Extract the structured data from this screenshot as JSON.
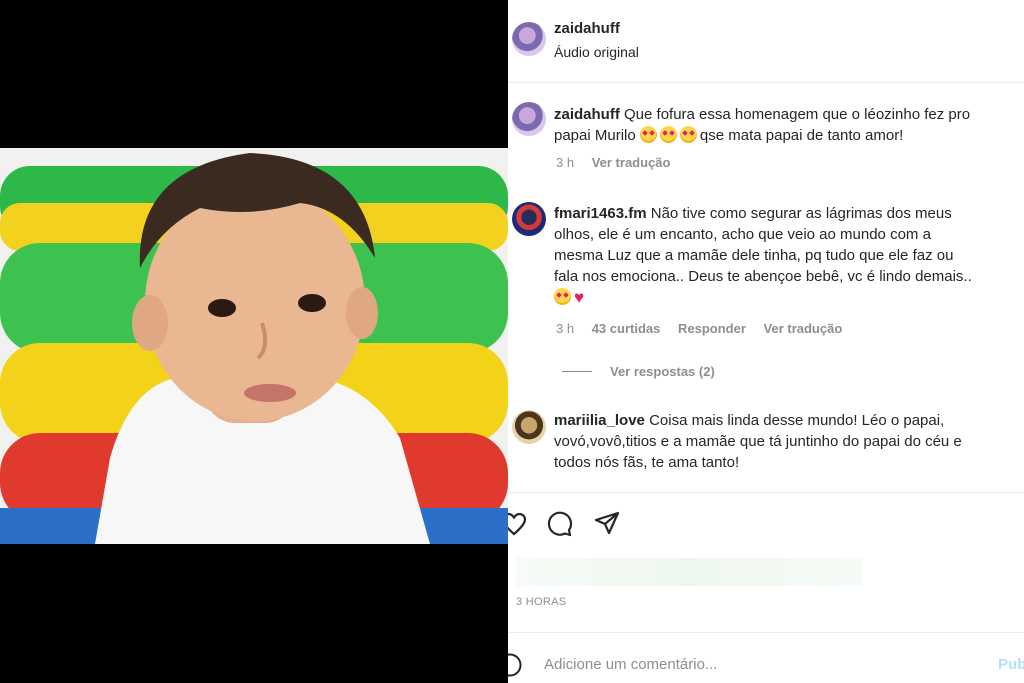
{
  "post": {
    "author": "zaidahuff",
    "audio": "Áudio original",
    "time_ago_caps": "3 HORAS",
    "add_comment_placeholder": "Adicione um comentário...",
    "publish_label": "Pub"
  },
  "comments": [
    {
      "username": "zaidahuff",
      "text_line1": "Que fofura essa homenagem que o léozinho fez pro",
      "text_line2a": "papai Murilo",
      "text_line2b": "qse mata papai de tanto amor!",
      "time": "3 h",
      "translate": "Ver tradução"
    },
    {
      "username": "fmari1463.fm",
      "text_line1": "Não tive como segurar as lágrimas dos meus",
      "text_line2": "olhos, ele é um encanto, acho que veio ao mundo com a",
      "text_line3": "mesma Luz que a mamãe dele tinha, pq tudo que ele faz ou",
      "text_line4": "fala nos emociona.. Deus te abençoe bebê, vc é lindo demais..",
      "time": "3 h",
      "likes": "43 curtidas",
      "reply": "Responder",
      "translate": "Ver tradução",
      "view_replies": "Ver respostas (2)"
    },
    {
      "username": "mariilia_love",
      "text_line1": "Coisa mais linda desse mundo! Léo o papai,",
      "text_line2": "vovó,vovô,titios e a mamãe que tá juntinho do papai do céu e",
      "text_line3": "todos nós fãs, te ama tanto!"
    }
  ],
  "icons": [
    "heart-icon",
    "comment-icon",
    "share-icon",
    "emoji-icon"
  ],
  "colors": {
    "accent_blue_disabled": "#b2dffc",
    "muted": "#8e8e8e",
    "text": "#262626"
  }
}
